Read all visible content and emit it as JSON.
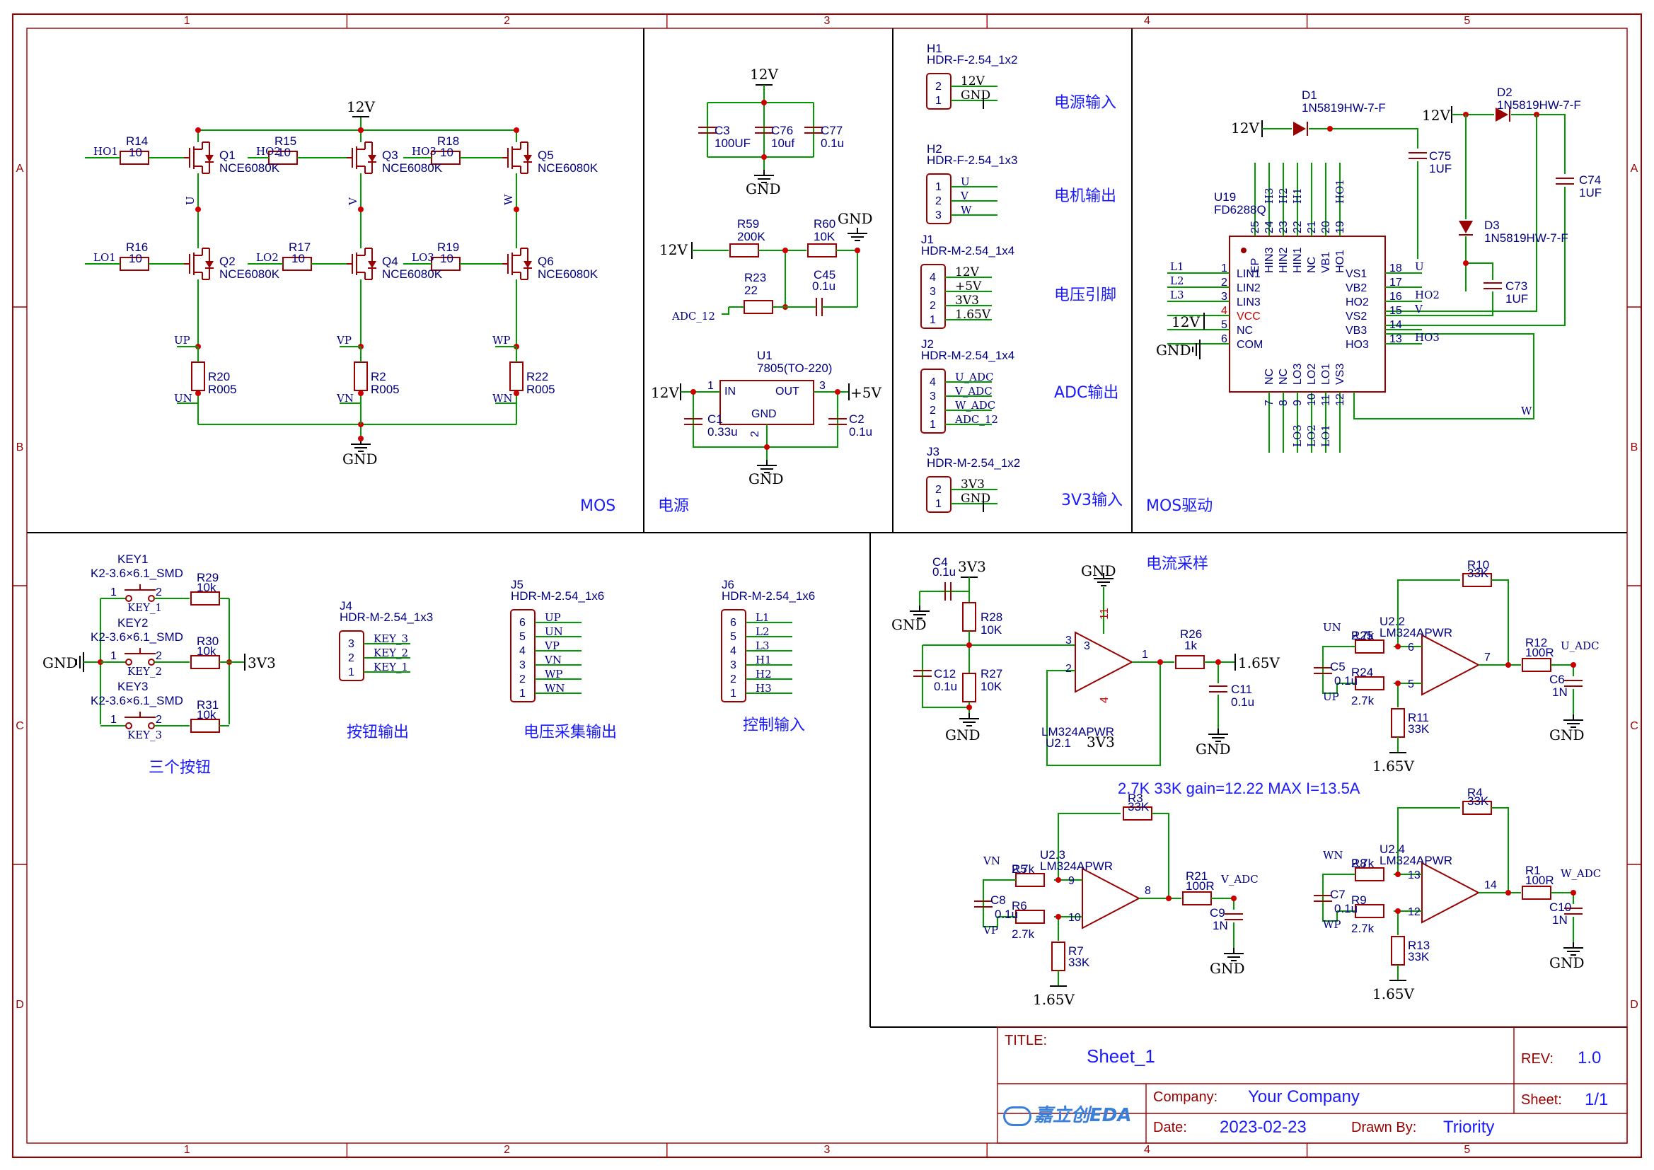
{
  "grid": {
    "cols": [
      "1",
      "2",
      "3",
      "4",
      "5"
    ],
    "rows": [
      "A",
      "B",
      "C",
      "D"
    ]
  },
  "blocks": {
    "mos": "MOS",
    "power": "电源",
    "mos_driver": "MOS驱动",
    "current_sense": "电流采样",
    "three_buttons": "三个按钮",
    "button_out": "按钮输出",
    "voltage_out": "电压采集输出",
    "control_in": "控制输入",
    "power_in": "电源输入",
    "motor_out": "电机输出",
    "voltage_pins": "电压引脚",
    "adc_out": "ADC输出",
    "v33_in": "3V3输入"
  },
  "note": "2.7K 33K gain=12.22 MAX I=13.5A",
  "titleblock": {
    "title_label": "TITLE:",
    "title": "Sheet_1",
    "rev_label": "REV:",
    "rev": "1.0",
    "company_label": "Company:",
    "company": "Your Company",
    "sheet_label": "Sheet:",
    "sheet": "1/1",
    "date_label": "Date:",
    "date": "2023-02-23",
    "drawn_label": "Drawn By:",
    "drawn": "Triority",
    "logo": "嘉立创EDA"
  },
  "power": {
    "v12": "12V",
    "gnd": "GND",
    "v33": "3V3",
    "v5": "+5V",
    "v165": "1.65V"
  },
  "mos": {
    "resistors": [
      {
        "ref": "R14",
        "val": "10",
        "net": "HO1"
      },
      {
        "ref": "R15",
        "val": "10",
        "net": "HO2"
      },
      {
        "ref": "R18",
        "val": "10",
        "net": "HO3"
      },
      {
        "ref": "R16",
        "val": "10",
        "net": "LO1"
      },
      {
        "ref": "R17",
        "val": "10",
        "net": "LO2"
      },
      {
        "ref": "R19",
        "val": "10",
        "net": "LO3"
      }
    ],
    "fets": [
      {
        "ref": "Q1",
        "val": "NCE6080K"
      },
      {
        "ref": "Q3",
        "val": "NCE6080K"
      },
      {
        "ref": "Q5",
        "val": "NCE6080K"
      },
      {
        "ref": "Q2",
        "val": "NCE6080K"
      },
      {
        "ref": "Q4",
        "val": "NCE6080K"
      },
      {
        "ref": "Q6",
        "val": "NCE6080K"
      }
    ],
    "phases": [
      "U",
      "V",
      "W"
    ],
    "shunts": [
      {
        "ref": "R20",
        "val": "R005",
        "top": "UP",
        "bot": "UN"
      },
      {
        "ref": "R2",
        "val": "R005",
        "top": "VP",
        "bot": "VN"
      },
      {
        "ref": "R22",
        "val": "R005",
        "top": "WP",
        "bot": "WN"
      }
    ]
  },
  "psu": {
    "caps": [
      {
        "ref": "C3",
        "val": "100UF"
      },
      {
        "ref": "C76",
        "val": "10uf"
      },
      {
        "ref": "C77",
        "val": "0.1u"
      }
    ],
    "r59": {
      "ref": "R59",
      "val": "200K"
    },
    "r60": {
      "ref": "R60",
      "val": "10K"
    },
    "r23": {
      "ref": "R23",
      "val": "22"
    },
    "c45": {
      "ref": "C45",
      "val": "0.1u"
    },
    "adc12": "ADC_12",
    "u1": {
      "ref": "U1",
      "val": "7805(TO-220)",
      "in": "IN",
      "out": "OUT",
      "gnd": "GND",
      "p1": "1",
      "p2": "2",
      "p3": "3"
    },
    "c1": {
      "ref": "C1",
      "val": "0.33u"
    },
    "c2": {
      "ref": "C2",
      "val": "0.1u"
    }
  },
  "connectors": {
    "h1": {
      "ref": "H1",
      "val": "HDR-F-2.54_1x2",
      "pins": [
        "2",
        "1"
      ],
      "nets": [
        "12V",
        "GND"
      ]
    },
    "h2": {
      "ref": "H2",
      "val": "HDR-F-2.54_1x3",
      "pins": [
        "1",
        "2",
        "3"
      ],
      "nets": [
        "U",
        "V",
        "W"
      ]
    },
    "j1": {
      "ref": "J1",
      "val": "HDR-M-2.54_1x4",
      "pins": [
        "4",
        "3",
        "2",
        "1"
      ],
      "nets": [
        "12V",
        "+5V",
        "3V3",
        "1.65V"
      ]
    },
    "j2": {
      "ref": "J2",
      "val": "HDR-M-2.54_1x4",
      "pins": [
        "4",
        "3",
        "2",
        "1"
      ],
      "nets": [
        "U_ADC",
        "V_ADC",
        "W_ADC",
        "ADC_12"
      ]
    },
    "j3": {
      "ref": "J3",
      "val": "HDR-M-2.54_1x2",
      "pins": [
        "2",
        "1"
      ],
      "nets": [
        "3V3",
        "GND"
      ]
    }
  },
  "driver": {
    "d1": {
      "ref": "D1",
      "val": "1N5819HW-7-F"
    },
    "d2": {
      "ref": "D2",
      "val": "1N5819HW-7-F"
    },
    "d3": {
      "ref": "D3",
      "val": "1N5819HW-7-F"
    },
    "c75": {
      "ref": "C75",
      "val": "1UF"
    },
    "c74": {
      "ref": "C74",
      "val": "1UF"
    },
    "c73": {
      "ref": "C73",
      "val": "1UF"
    },
    "u19": {
      "ref": "U19",
      "val": "FD6288Q"
    },
    "left_pins": [
      {
        "num": "1",
        "name": "LIN1",
        "net": "L1"
      },
      {
        "num": "2",
        "name": "LIN2",
        "net": "L2"
      },
      {
        "num": "3",
        "name": "LIN3",
        "net": "L3"
      },
      {
        "num": "4",
        "name": "VCC",
        "net": "12V"
      },
      {
        "num": "5",
        "name": "NC",
        "net": ""
      },
      {
        "num": "6",
        "name": "COM",
        "net": "GND"
      }
    ],
    "right_pins": [
      {
        "num": "18",
        "name": "VS1",
        "net": "U"
      },
      {
        "num": "17",
        "name": "VB2",
        "net": ""
      },
      {
        "num": "16",
        "name": "HO2",
        "net": "HO2"
      },
      {
        "num": "15",
        "name": "VS2",
        "net": "V"
      },
      {
        "num": "14",
        "name": "VB3",
        "net": ""
      },
      {
        "num": "13",
        "name": "HO3",
        "net": "HO3"
      }
    ],
    "top_pins": [
      {
        "num": "25",
        "name": "EP",
        "net": ""
      },
      {
        "num": "24",
        "name": "HIN3",
        "net": "H3"
      },
      {
        "num": "23",
        "name": "HIN2",
        "net": "H2"
      },
      {
        "num": "22",
        "name": "HIN1",
        "net": "H1"
      },
      {
        "num": "21",
        "name": "NC",
        "net": ""
      },
      {
        "num": "20",
        "name": "VB1",
        "net": ""
      },
      {
        "num": "19",
        "name": "HO1",
        "net": "HO1"
      }
    ],
    "bottom_pins": [
      {
        "num": "7",
        "name": "NC",
        "net": ""
      },
      {
        "num": "8",
        "name": "NC",
        "net": ""
      },
      {
        "num": "9",
        "name": "LO3",
        "net": "LO3"
      },
      {
        "num": "10",
        "name": "LO2",
        "net": "LO2"
      },
      {
        "num": "11",
        "name": "LO1",
        "net": "LO1"
      },
      {
        "num": "12",
        "name": "VS3",
        "net": "W"
      }
    ]
  },
  "buttons": {
    "keys": [
      {
        "ref": "KEY1",
        "val": "K2-3.6×6.1_SMD",
        "net": "KEY_1",
        "r": "R29",
        "rv": "10k"
      },
      {
        "ref": "KEY2",
        "val": "K2-3.6×6.1_SMD",
        "net": "KEY_2",
        "r": "R30",
        "rv": "10k"
      },
      {
        "ref": "KEY3",
        "val": "K2-3.6×6.1_SMD",
        "net": "KEY_3",
        "r": "R31",
        "rv": "10k"
      }
    ],
    "pin1": "1",
    "pin2": "2",
    "j4": {
      "ref": "J4",
      "val": "HDR-M-2.54_1x3",
      "pins": [
        "3",
        "2",
        "1"
      ],
      "nets": [
        "KEY_3",
        "KEY_2",
        "KEY_1"
      ]
    },
    "j5": {
      "ref": "J5",
      "val": "HDR-M-2.54_1x6",
      "pins": [
        "6",
        "5",
        "4",
        "3",
        "2",
        "1"
      ],
      "nets": [
        "UP",
        "UN",
        "VP",
        "VN",
        "WP",
        "WN"
      ]
    },
    "j6": {
      "ref": "J6",
      "val": "HDR-M-2.54_1x6",
      "pins": [
        "6",
        "5",
        "4",
        "3",
        "2",
        "1"
      ],
      "nets": [
        "L1",
        "L2",
        "L3",
        "H1",
        "H2",
        "H3"
      ]
    }
  },
  "sense": {
    "c4": {
      "ref": "C4",
      "val": "0.1u"
    },
    "r28": {
      "ref": "R28",
      "val": "10K"
    },
    "r27": {
      "ref": "R27",
      "val": "10K"
    },
    "c12": {
      "ref": "C12",
      "val": "0.1u"
    },
    "u21": {
      "ref": "U2.1",
      "val": "LM324APWR",
      "p3": "3",
      "p2": "2",
      "p1": "1",
      "p11": "11",
      "p4": "4"
    },
    "r26": {
      "ref": "R26",
      "val": "1k"
    },
    "c11": {
      "ref": "C11",
      "val": "0.1u"
    },
    "amps": [
      {
        "u": "U2.2",
        "uv": "LM324APWR",
        "rf": "R10",
        "rfv": "33K",
        "ra": "R25",
        "rav": "2.7k",
        "rb": "R24",
        "rbv": "2.7k",
        "rg": "R11",
        "rgv": "33K",
        "c": "C5",
        "cv": "0.1u",
        "ro": "R12",
        "rov": "100R",
        "co": "C6",
        "cov": "1N",
        "in1": "UN",
        "in2": "UP",
        "out": "U_ADC",
        "pp": "5",
        "pn": "6",
        "po": "7"
      },
      {
        "u": "U2.3",
        "uv": "LM324APWR",
        "rf": "R3",
        "rfv": "33K",
        "ra": "R5",
        "rav": "2.7k",
        "rb": "R6",
        "rbv": "2.7k",
        "rg": "R7",
        "rgv": "33K",
        "c": "C8",
        "cv": "0.1u",
        "ro": "R21",
        "rov": "100R",
        "co": "C9",
        "cov": "1N",
        "in1": "VN",
        "in2": "VP",
        "out": "V_ADC",
        "pp": "10",
        "pn": "9",
        "po": "8"
      },
      {
        "u": "U2.4",
        "uv": "LM324APWR",
        "rf": "R4",
        "rfv": "33K",
        "ra": "R8",
        "rav": "2.7k",
        "rb": "R9",
        "rbv": "2.7k",
        "rg": "R13",
        "rgv": "33K",
        "c": "C7",
        "cv": "0.1u",
        "ro": "R1",
        "rov": "100R",
        "co": "C10",
        "cov": "1N",
        "in1": "WN",
        "in2": "WP",
        "out": "W_ADC",
        "pp": "12",
        "pn": "13",
        "po": "14"
      }
    ]
  },
  "colors": {
    "frame": "#990000",
    "wire": "#009900",
    "text": "#000080",
    "label": "#1a1aff"
  }
}
